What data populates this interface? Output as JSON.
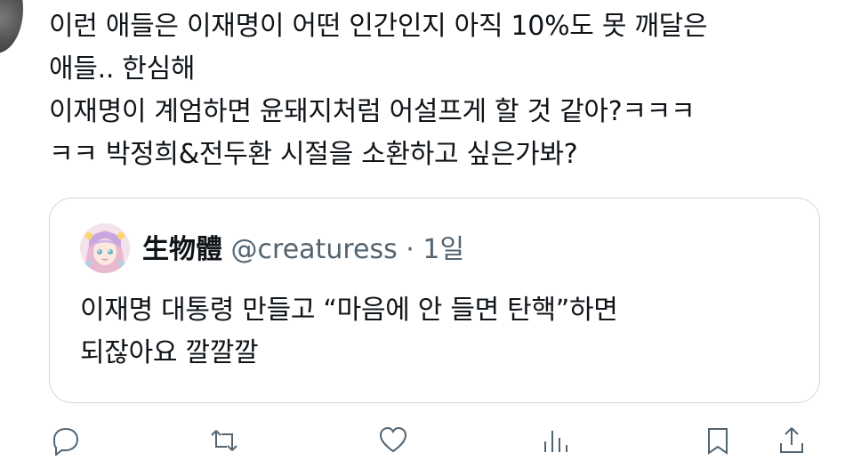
{
  "tweet": {
    "text_lines": [
      "이런 애들은 이재명이 어떤 인간인지 아직 10%도 못 깨달은",
      "애들.. 한심해",
      "이재명이 계엄하면 윤돼지처럼 어설프게 할 것 같아?ㅋㅋㅋ",
      "ㅋㅋ 박정희&전두환 시절을 소환하고 싶은가봐?"
    ]
  },
  "quote": {
    "name": "生物體",
    "handle": "@creaturess",
    "separator": "·",
    "time": "1일",
    "text_lines": [
      "이재명 대통령 만들고 “마음에 안 들면 탄핵”하면",
      "되잖아요 깔깔깔"
    ]
  },
  "actions": {
    "reply_icon": "reply-icon",
    "retweet_icon": "retweet-icon",
    "like_icon": "heart-icon",
    "views_icon": "views-icon",
    "bookmark_icon": "bookmark-icon",
    "share_icon": "share-icon"
  },
  "colors": {
    "text": "#0f1419",
    "secondary": "#536471",
    "border": "#cfd9de"
  }
}
